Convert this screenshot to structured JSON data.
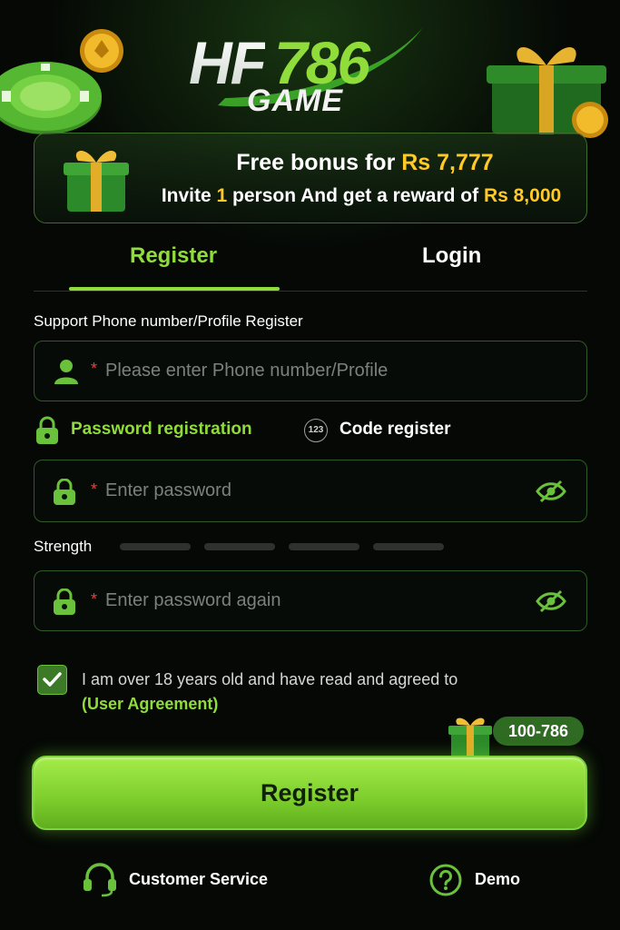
{
  "brand": {
    "logo_text_hf": "HF",
    "logo_text_num": "786",
    "logo_text_game": "GAME"
  },
  "bonus": {
    "line1_prefix": "Free bonus for ",
    "line1_amount": "Rs 7,777",
    "line2_part1": "Invite ",
    "line2_count": "1",
    "line2_part2": " person And get a reward of ",
    "line2_amount": "Rs 8,000",
    "icon": "gift-icon"
  },
  "tabs": [
    {
      "label": "Register",
      "active": true
    },
    {
      "label": "Login",
      "active": false
    }
  ],
  "form": {
    "phone_label": "Support Phone number/Profile Register",
    "phone_placeholder": "Please enter Phone number/Profile",
    "required_mark": "*",
    "options": [
      {
        "label": "Password registration",
        "active": true,
        "icon": "lock-icon"
      },
      {
        "label": "Code register",
        "active": false,
        "icon": "code-123-icon"
      }
    ],
    "code_badge": "123",
    "password_placeholder": "Enter password",
    "strength_label": "Strength",
    "strength_level": 0,
    "confirm_placeholder": "Enter password again",
    "agree_checked": true,
    "agree_text": "I am over 18 years old and have read and agreed to",
    "agree_link": "(User Agreement)"
  },
  "promo_badge": "100-786",
  "register_button": "Register",
  "footer": {
    "customer_service": "Customer Service",
    "demo": "Demo"
  },
  "colors": {
    "accent": "#8fdc3a",
    "gold": "#ffc928",
    "background": "#050805",
    "required": "#e8413a"
  }
}
